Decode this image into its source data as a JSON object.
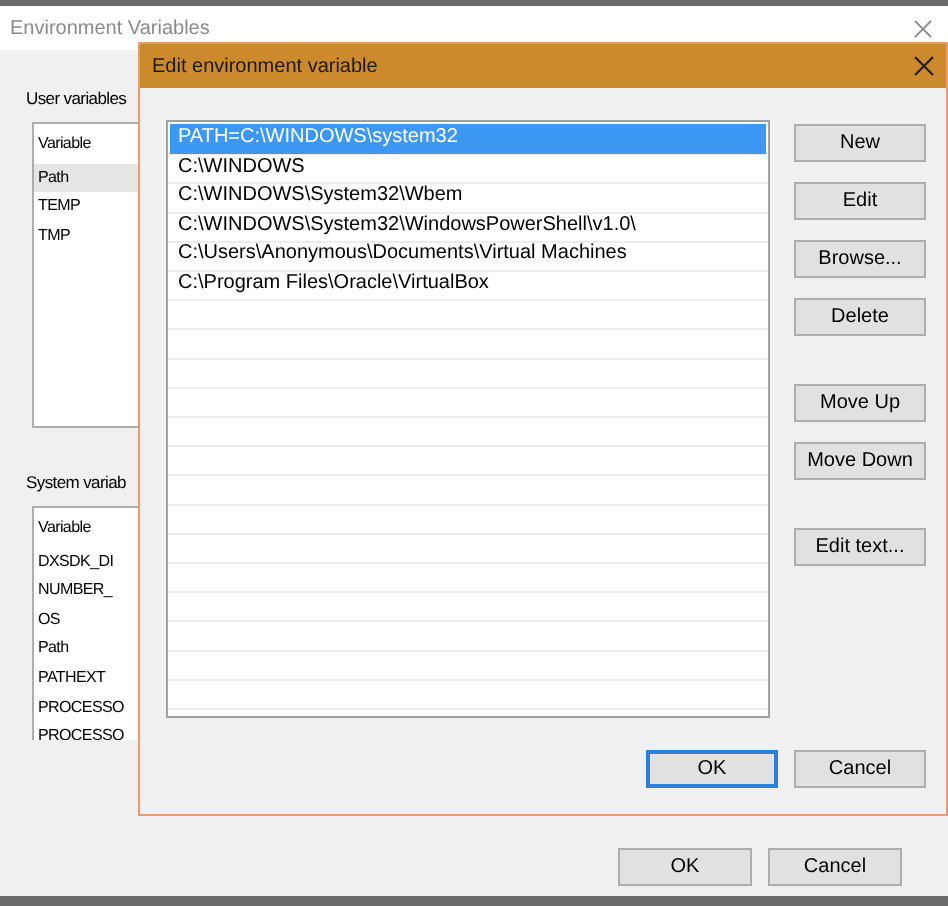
{
  "background_window": {
    "title": "Environment Variables",
    "user_variables": {
      "label": "User variables",
      "column": "Variable",
      "rows": [
        {
          "name": "Path",
          "selected": true
        },
        {
          "name": "TEMP",
          "selected": false
        },
        {
          "name": "TMP",
          "selected": false
        }
      ]
    },
    "system_variables": {
      "label": "System variab",
      "column": "Variable",
      "rows": [
        {
          "name": "DXSDK_DI",
          "selected": false
        },
        {
          "name": "NUMBER_",
          "selected": false
        },
        {
          "name": "OS",
          "selected": false
        },
        {
          "name": "Path",
          "selected": false
        },
        {
          "name": "PATHEXT",
          "selected": false
        },
        {
          "name": "PROCESSO",
          "selected": false
        },
        {
          "name": "PROCESSO",
          "selected": false
        }
      ]
    },
    "buttons": [
      {
        "label": "OK",
        "default": false
      },
      {
        "label": "Cancel",
        "default": false
      }
    ]
  },
  "dialog": {
    "title": "Edit environment variable",
    "entries": [
      {
        "text": "PATH=C:\\WINDOWS\\system32",
        "selected": true
      },
      {
        "text": "C:\\WINDOWS",
        "selected": false
      },
      {
        "text": "C:\\WINDOWS\\System32\\Wbem",
        "selected": false
      },
      {
        "text": "C:\\WINDOWS\\System32\\WindowsPowerShell\\v1.0\\",
        "selected": false
      },
      {
        "text": "C:\\Users\\Anonymous\\Documents\\Virtual Machines",
        "selected": false
      },
      {
        "text": "C:\\Program Files\\Oracle\\VirtualBox",
        "selected": false
      }
    ],
    "side_buttons": [
      [
        "New",
        "Edit",
        "Browse...",
        "Delete"
      ],
      [
        "Move Up",
        "Move Down"
      ],
      [
        "Edit text..."
      ]
    ],
    "buttons": [
      {
        "label": "OK",
        "default": true
      },
      {
        "label": "Cancel",
        "default": false
      }
    ]
  }
}
